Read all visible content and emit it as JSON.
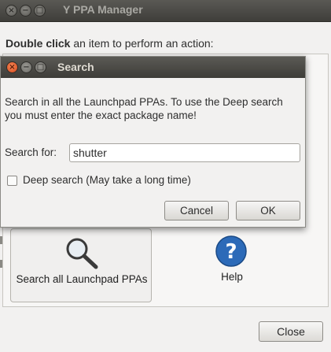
{
  "main_window": {
    "title": "Y PPA Manager",
    "instruction_bold": "Double click",
    "instruction_rest": " an item to perform an action:",
    "actions": [
      {
        "label": "Search all Launchpad PPAs",
        "icon": "magnifier-icon"
      },
      {
        "label": "Help",
        "icon": "help-icon"
      }
    ],
    "close_label": "Close"
  },
  "dialog": {
    "title": "Search",
    "description": "Search in all the Launchpad PPAs. To use the Deep search you must enter the exact package name!",
    "search_label": "Search for:",
    "search_value": "shutter",
    "deep_search_label": "Deep search (May take a long time)",
    "deep_search_checked": false,
    "cancel_label": "Cancel",
    "ok_label": "OK"
  },
  "colors": {
    "titlebar": "#3f3e3a",
    "close_button": "#e45f2b",
    "window_bg": "#f2f1f0",
    "help_icon": "#2c6ab8"
  }
}
